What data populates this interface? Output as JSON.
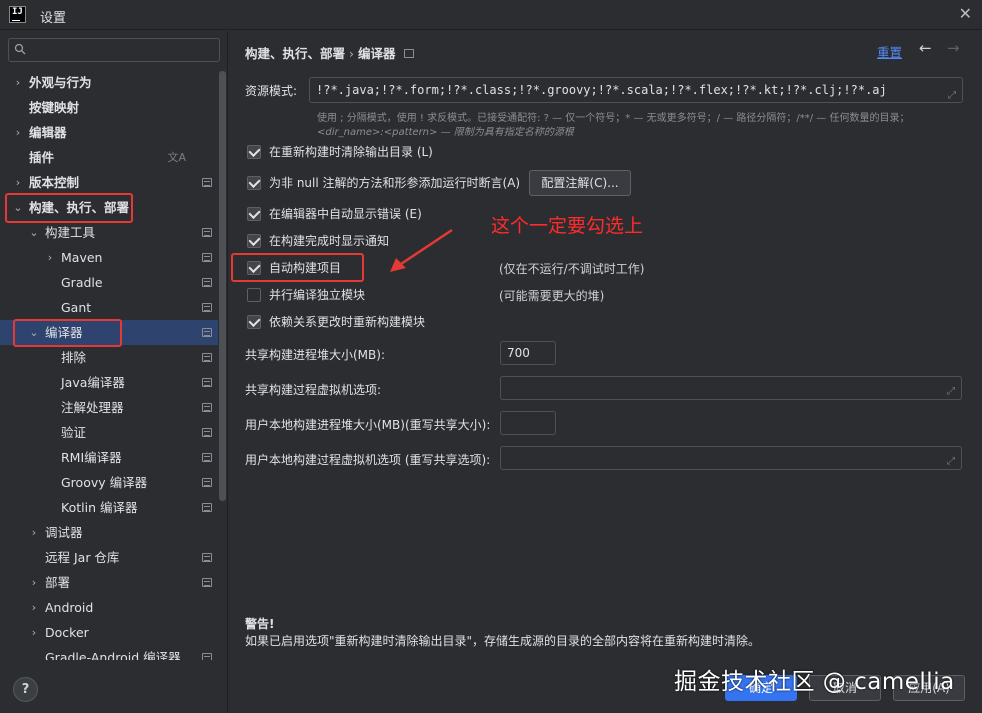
{
  "window": {
    "title": "设置",
    "close_glyph": "✕"
  },
  "app_icon": {
    "text": "IJ"
  },
  "search": {
    "placeholder": "",
    "icon": "search-icon"
  },
  "tree": [
    {
      "label": "外观与行为",
      "arrow": "›",
      "bold": true
    },
    {
      "label": "按键映射",
      "arrow": "",
      "bold": true
    },
    {
      "label": "编辑器",
      "arrow": "›",
      "bold": true
    },
    {
      "label": "插件",
      "arrow": "",
      "bold": true,
      "translate_glyph": "文A"
    },
    {
      "label": "版本控制",
      "arrow": "›",
      "bold": true
    },
    {
      "label": "构建、执行、部署",
      "arrow": "⌄",
      "bold": true
    },
    {
      "label": "构建工具",
      "arrow": "⌄"
    },
    {
      "label": "Maven",
      "arrow": "›"
    },
    {
      "label": "Gradle",
      "arrow": ""
    },
    {
      "label": "Gant",
      "arrow": ""
    },
    {
      "label": "编译器",
      "arrow": "⌄"
    },
    {
      "label": "排除",
      "arrow": ""
    },
    {
      "label": "Java编译器",
      "arrow": ""
    },
    {
      "label": "注解处理器",
      "arrow": ""
    },
    {
      "label": "验证",
      "arrow": ""
    },
    {
      "label": "RMI编译器",
      "arrow": ""
    },
    {
      "label": "Groovy 编译器",
      "arrow": ""
    },
    {
      "label": "Kotlin 编译器",
      "arrow": ""
    },
    {
      "label": "调试器",
      "arrow": "›"
    },
    {
      "label": "远程 Jar 仓库",
      "arrow": ""
    },
    {
      "label": "部署",
      "arrow": "›"
    },
    {
      "label": "Android",
      "arrow": "›"
    },
    {
      "label": "Docker",
      "arrow": "›"
    },
    {
      "label": "Gradle-Android 编译器",
      "arrow": ""
    }
  ],
  "help": {
    "label": "?"
  },
  "breadcrumb": {
    "part1": "构建、执行、部署",
    "separator": "›",
    "part2": "编译器"
  },
  "header": {
    "reset_label": "重置",
    "back_glyph": "←",
    "forward_glyph": "→"
  },
  "resource_patterns": {
    "label": "资源模式:",
    "value": "!?*.java;!?*.form;!?*.class;!?*.groovy;!?*.scala;!?*.flex;!?*.kt;!?*.clj;!?*.aj",
    "hint_line1": "使用 ; 分隔模式，使用 ! 求反模式。已接受通配符: ? — 仅一个符号；* — 无或更多符号；/ — 路径分隔符；/**/ — 任何数量的目录；",
    "hint_line2": "<dir_name>:<pattern> — 限制为具有指定名称的源根"
  },
  "options": [
    {
      "label": "在重新构建时清除输出目录 (L)",
      "checked": true
    },
    {
      "label": "为非 null 注解的方法和形参添加运行时断言(A)",
      "checked": true
    },
    {
      "label": "在编辑器中自动显示错误 (E)",
      "checked": true
    },
    {
      "label": "在构建完成时显示通知",
      "checked": true
    },
    {
      "label": "自动构建项目",
      "checked": true,
      "note": "(仅在不运行/不调试时工作)"
    },
    {
      "label": "并行编译独立模块",
      "checked": false,
      "note": "(可能需要更大的堆)"
    },
    {
      "label": "依赖关系更改时重新构建模块",
      "checked": true
    }
  ],
  "configure_annotations_label": "配置注解(C)...",
  "fields": {
    "shared_heap_label": "共享构建进程堆大小(MB):",
    "shared_heap_value": "700",
    "shared_vm_label": "共享构建过程虚拟机选项:",
    "shared_vm_value": "",
    "user_heap_label": "用户本地构建进程堆大小(MB)(重写共享大小):",
    "user_heap_value": "",
    "user_vm_label": "用户本地构建过程虚拟机选项 (重写共享选项):",
    "user_vm_value": ""
  },
  "annotation": {
    "text": "这个一定要勾选上",
    "color": "#ff2b2b"
  },
  "warning": {
    "title": "警告!",
    "text": "如果已启用选项\"重新构建时清除输出目录\"，存储生成源的目录的全部内容将在重新构建时清除。"
  },
  "buttons": {
    "ok": "确定",
    "cancel": "取消",
    "apply": "应用(A)"
  },
  "watermark": "掘金技术社区 @ camellia",
  "colors": {
    "accent": "#3574f0",
    "selection": "#2e436e",
    "highlight_box": "#e53935",
    "link": "#548af7"
  }
}
